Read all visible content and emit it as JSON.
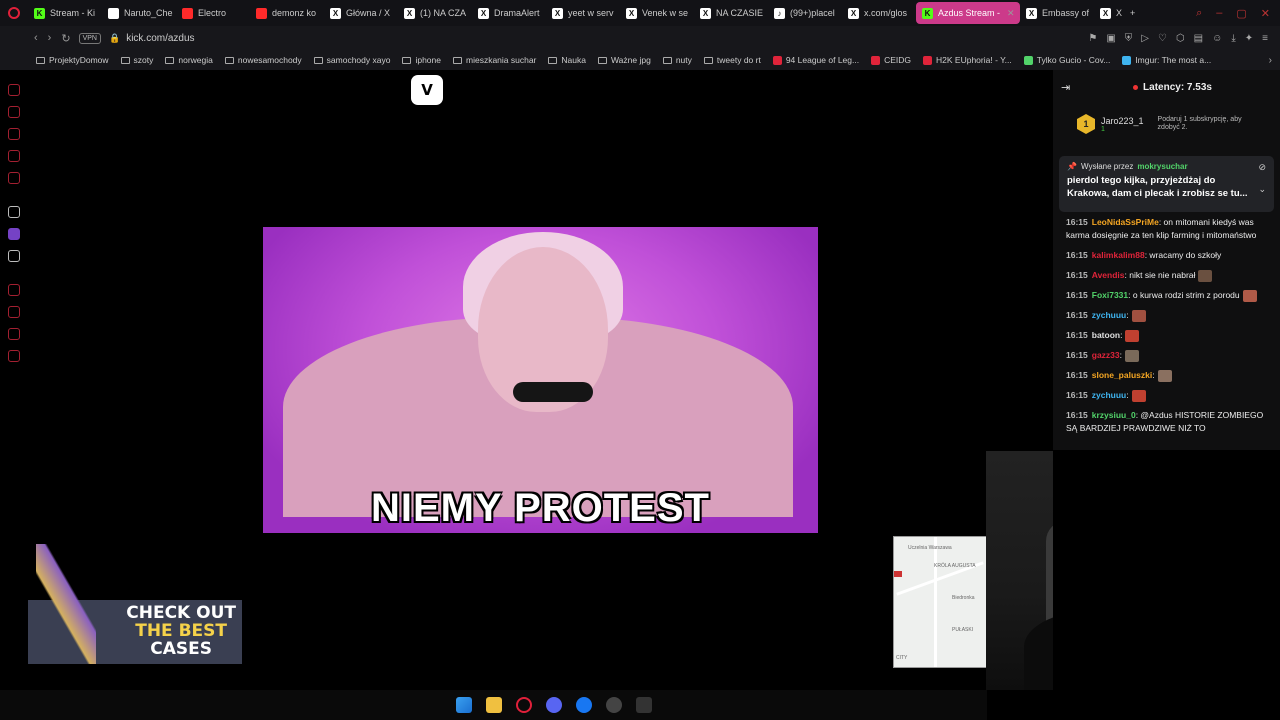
{
  "tabs": [
    {
      "label": "Stream - Ki",
      "fav": "K",
      "color": "#53fc18"
    },
    {
      "label": "Naruto_Che",
      "fav": "",
      "color": "#ffffff"
    },
    {
      "label": "Electro",
      "fav": "",
      "color": "#ff2a2a"
    },
    {
      "label": "demonz ko",
      "fav": "",
      "color": "#ff2a2a"
    },
    {
      "label": "Główna / X",
      "fav": "X",
      "color": "#ffffff"
    },
    {
      "label": "(1) NA CZA",
      "fav": "X",
      "color": "#ffffff"
    },
    {
      "label": "DramaAlert",
      "fav": "X",
      "color": "#ffffff"
    },
    {
      "label": "yeet w serv",
      "fav": "X",
      "color": "#ffffff"
    },
    {
      "label": "Venek w se",
      "fav": "X",
      "color": "#ffffff"
    },
    {
      "label": "NA CZASIE",
      "fav": "X",
      "color": "#ffffff"
    },
    {
      "label": "(99+)placel",
      "fav": "♪",
      "color": "#ffffff"
    },
    {
      "label": "x.com/glos",
      "fav": "X",
      "color": "#ffffff"
    },
    {
      "label": "Azdus Stream -",
      "fav": "K",
      "color": "#53fc18"
    },
    {
      "label": "Embassy of",
      "fav": "X",
      "color": "#ffffff"
    },
    {
      "label": "X",
      "fav": "X",
      "color": "#ffffff"
    }
  ],
  "address": {
    "vpn": "VPN",
    "url": "kick.com/azdus"
  },
  "bookmarks": [
    {
      "label": "ProjektyDomow",
      "kind": "folder"
    },
    {
      "label": "szoty",
      "kind": "folder"
    },
    {
      "label": "norwegia",
      "kind": "folder"
    },
    {
      "label": "nowesamochody",
      "kind": "folder"
    },
    {
      "label": "samochody xayo",
      "kind": "folder"
    },
    {
      "label": "iphone",
      "kind": "folder"
    },
    {
      "label": "mieszkania suchar",
      "kind": "folder"
    },
    {
      "label": "Nauka",
      "kind": "folder"
    },
    {
      "label": "Ważne jpg",
      "kind": "folder"
    },
    {
      "label": "nuty",
      "kind": "folder"
    },
    {
      "label": "tweety do rt",
      "kind": "folder"
    },
    {
      "label": "94 League of Leg...",
      "kind": "site"
    },
    {
      "label": "CEIDG",
      "kind": "site"
    },
    {
      "label": "H2K EUphoria! - Y...",
      "kind": "site"
    },
    {
      "label": "Tylko Gucio - Cov...",
      "kind": "site"
    },
    {
      "label": "Imgur: The most a...",
      "kind": "site"
    }
  ],
  "stream": {
    "logo": "V",
    "clip_caption": "NIEMY PROTEST",
    "promo_line1": "CHECK OUT",
    "promo_line2": "THE BEST",
    "promo_line3": "CASES",
    "map_labels": [
      "Uczelnia Warszawa",
      "KRÓLA AUGUSTA",
      "Biedronka",
      "PUŁASKI",
      "CITY"
    ]
  },
  "chat": {
    "latency": "Latency: 7.53s",
    "sub_rank": "1",
    "sub_user": "Jaro223_1",
    "sub_count": "1",
    "sub_hint": "Podaruj 1 subskrypcję, aby zdobyć 2.",
    "pinned_prefix": "Wysłane przez",
    "pinned_by": "mokrysuchar",
    "pinned_msg": "pierdol tego kijka, przyjeżdżaj do Krakowa, dam ci plecak i zrobisz se tu...",
    "messages": [
      {
        "time": "16:15",
        "user": "LeoNidaSsPriMe",
        "color": "#f5a623",
        "text": ": on mitomani kiedyś was karma dosięgnie za ten klip farming i mitomaństwo"
      },
      {
        "time": "16:15",
        "user": "kalimkalim88",
        "color": "#e0243a",
        "text": ": wracamy do szkoły"
      },
      {
        "time": "16:15",
        "user": "Avendis",
        "color": "#e0243a",
        "text": ": nikt sie nie nabrał"
      },
      {
        "time": "16:15",
        "user": "Foxi7331",
        "color": "#52d36a",
        "text": ": o kurwa rodzi strim z porodu"
      },
      {
        "time": "16:15",
        "user": "zychuuu",
        "color": "#3fb4f0",
        "text": ":"
      },
      {
        "time": "16:15",
        "user": "batoon",
        "color": "#e0e0e0",
        "text": ":"
      },
      {
        "time": "16:15",
        "user": "gazz33",
        "color": "#e0243a",
        "text": ":"
      },
      {
        "time": "16:15",
        "user": "slone_paluszki",
        "color": "#f5a623",
        "text": ":"
      },
      {
        "time": "16:15",
        "user": "zychuuu",
        "color": "#3fb4f0",
        "text": ":"
      },
      {
        "time": "16:15",
        "user": "krzysiuu_0",
        "color": "#52d36a",
        "text": ": @Azdus HISTORIE ZOMBIEGO SĄ BARDZIEJ PRAWDZIWE NIŻ TO"
      }
    ]
  },
  "colors": {
    "accent": "#53fc18",
    "active_tab": "#cc3a8a",
    "opera": "#e0203a"
  }
}
